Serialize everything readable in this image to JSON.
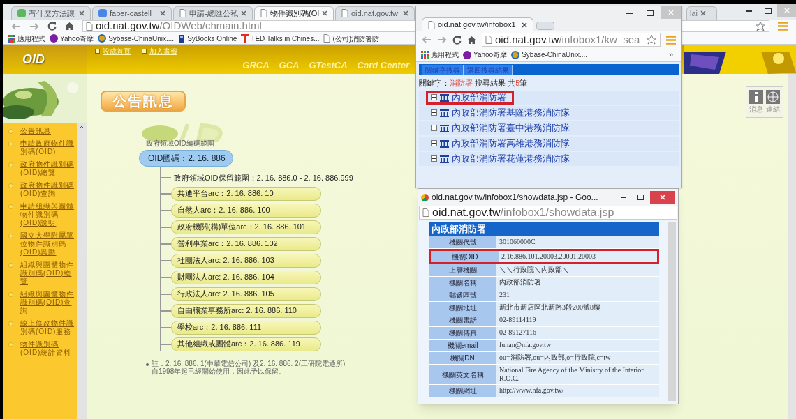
{
  "main": {
    "tabs": [
      {
        "label": "有什麼方法讓",
        "kind": "app",
        "selected": false
      },
      {
        "label": "faber-castell",
        "kind": "g",
        "selected": false
      },
      {
        "label": "申請-總匯公私",
        "kind": "page",
        "selected": false
      },
      {
        "label": "物件識別碼(OI",
        "kind": "page",
        "selected": true
      },
      {
        "label": "oid.nat.gov.tw",
        "kind": "page",
        "selected": false
      }
    ],
    "far_tab": {
      "label": "lai"
    },
    "address": {
      "host": "oid.nat.gov.tw",
      "path": "/OIDWeb/chmain.html"
    },
    "bookmarks": [
      {
        "label": "應用程式",
        "kind": "apps"
      },
      {
        "label": "Yahoo奇摩",
        "kind": "yahoo"
      },
      {
        "label": "Sybase-ChinaUnix....",
        "kind": "sybase"
      },
      {
        "label": "SyBooks Online",
        "kind": "book"
      },
      {
        "label": "TED Talks in Chines...",
        "kind": "ted"
      },
      {
        "label": "(公司)消防署防",
        "kind": "page"
      }
    ],
    "site": {
      "logo": "OID",
      "top_links": [
        "設成首頁",
        "加入書籤"
      ],
      "nav": [
        "GRCA",
        "GCA",
        "GTestCA",
        "Card Center"
      ],
      "side_menu": [
        "公告訊息",
        "申請政府物件識別碼(OID)",
        "政府物件識別碼(OID)總覽",
        "政府物件識別碼(OID)查詢",
        "申請組織與團體物件識別碼(OID)說明",
        "國立大學附屬單位物件識別碼(OID)異動",
        "組織與團體物件識別碼(OID)總覽",
        "組織與團體物件識別碼(OID)查詢",
        "線上修改物件識別碼(OID)服務",
        "物件識別碼(OID)統計資料"
      ],
      "heading": "公告訊息",
      "side_buttons": [
        {
          "label": "消息",
          "kind": "info"
        },
        {
          "label": "連結",
          "kind": "globe"
        }
      ],
      "diagram": {
        "caption": "政府領域OID編碼範圍",
        "root": "OID國碼：2. 16. 886",
        "reserved": "政府領域OID保留範圍：2. 16. 886.0 - 2. 16. 886.999",
        "arcs": [
          "共通平台arc：2. 16. 886. 10",
          "自然人arc：2. 16. 886. 100",
          "政府機關(構)單位arc：2. 16. 886. 101",
          "營利事業arc：2. 16. 886. 102",
          "社團法人arc: 2. 16. 886. 103",
          "財團法人arc: 2. 16. 886. 104",
          "行政法人arc: 2. 16. 886. 105",
          "自由職業事務所arc: 2. 16. 886. 110",
          "學校arc：2. 16. 886. 111",
          "其他組織或團體arc：2. 16. 886. 119"
        ]
      },
      "note_lines": [
        "註：2. 16. 886. 1(中華電信公司) 及2. 16. 886. 2(工研院電通所)",
        "自1998年起已經開始使用，因此予以保留。"
      ]
    }
  },
  "search_window": {
    "tab": "oid.nat.gov.tw/infobox1",
    "address": {
      "host": "oid.nat.gov.tw",
      "path": "/infobox1/kw_sea"
    },
    "bookmarks": [
      {
        "label": "應用程式",
        "kind": "apps"
      },
      {
        "label": "Yahoo奇摩",
        "kind": "yahoo"
      },
      {
        "label": "Sybase-ChinaUnix....",
        "kind": "sybase"
      }
    ],
    "more": "»",
    "links": [
      "關鍵字搜尋",
      "返回搜尋結果"
    ],
    "query": {
      "label": "關鍵字：",
      "keyword": "消防署",
      "summary": "搜尋結果 共",
      "count": "5",
      "unit": "筆"
    },
    "results": [
      {
        "name": "內政部消防署",
        "highlighted": true
      },
      {
        "name": "內政部消防署基隆港務消防隊",
        "highlighted": false
      },
      {
        "name": "內政部消防署臺中港務消防隊",
        "highlighted": false
      },
      {
        "name": "內政部消防署高雄港務消防隊",
        "highlighted": false
      },
      {
        "name": "內政部消防署花蓮港務消防隊",
        "highlighted": false
      }
    ]
  },
  "detail_window": {
    "title": "oid.nat.gov.tw/infobox1/showdata.jsp - Goo...",
    "address": {
      "host": "oid.nat.gov.tw",
      "path": "/infobox1/showdata.jsp"
    },
    "header": "內政部消防署",
    "rows": [
      {
        "label": "機關代號",
        "value": "301060000C",
        "highlighted": false
      },
      {
        "label": "機關OID",
        "value": "2.16.886.101.20003.20001.20003",
        "highlighted": true
      },
      {
        "label": "上層機關",
        "value": "＼＼行政院＼內政部＼",
        "highlighted": false
      },
      {
        "label": "機關名稱",
        "value": "內政部消防署",
        "highlighted": false
      },
      {
        "label": "郵遞區號",
        "value": "231",
        "highlighted": false
      },
      {
        "label": "機關地址",
        "value": "新北市新店區北新路3段200號8樓",
        "highlighted": false
      },
      {
        "label": "機關電話",
        "value": "02-89114119",
        "highlighted": false
      },
      {
        "label": "機關傳真",
        "value": "02-89127116",
        "highlighted": false
      },
      {
        "label": "機關email",
        "value": "funan@nfa.gov.tw",
        "highlighted": false
      },
      {
        "label": "機關DN",
        "value": "ou=消防署,ou=內政部,o=行政院,c=tw",
        "highlighted": false
      },
      {
        "label": "機關英文名稱",
        "value": "National Fire Agency of the Ministry of the Interior R.O.C.",
        "highlighted": false
      },
      {
        "label": "機關網址",
        "value": "http://www.nfa.gov.tw/",
        "highlighted": false
      }
    ]
  }
}
